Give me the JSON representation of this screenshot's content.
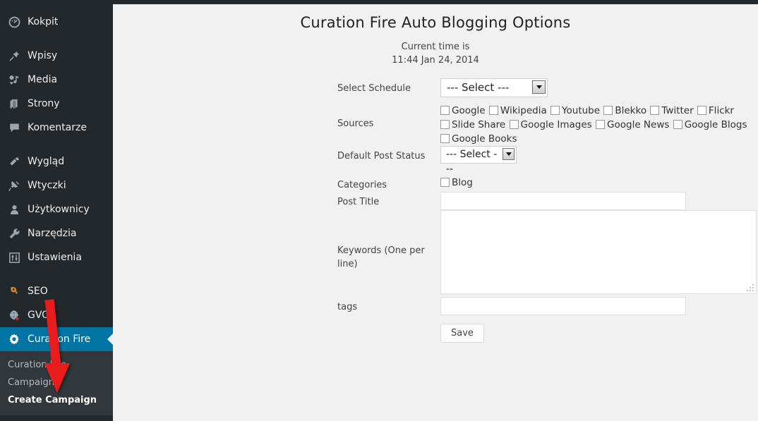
{
  "sidebar": {
    "groups": [
      {
        "items": [
          {
            "label": "Kokpit",
            "icon": "dashboard-icon"
          }
        ]
      },
      {
        "items": [
          {
            "label": "Wpisy",
            "icon": "pin-icon"
          },
          {
            "label": "Media",
            "icon": "media-icon"
          },
          {
            "label": "Strony",
            "icon": "pages-icon"
          },
          {
            "label": "Komentarze",
            "icon": "comment-icon"
          }
        ]
      },
      {
        "items": [
          {
            "label": "Wygląd",
            "icon": "appearance-brush-icon"
          },
          {
            "label": "Wtyczki",
            "icon": "plugins-plug-icon"
          },
          {
            "label": "Użytkownicy",
            "icon": "users-icon"
          },
          {
            "label": "Narzędzia",
            "icon": "tools-wrench-icon"
          },
          {
            "label": "Ustawienia",
            "icon": "settings-sliders-icon"
          }
        ]
      },
      {
        "items": [
          {
            "label": "SEO",
            "icon": "seo-yoast-icon"
          },
          {
            "label": "GVO",
            "icon": "gvo-globe-icon"
          }
        ]
      }
    ],
    "active_item": {
      "label": "Curation Fire",
      "icon": "gear-icon"
    },
    "submenu": [
      {
        "label": "Curation Fire",
        "current": false
      },
      {
        "label": "Campaigns",
        "current": false
      },
      {
        "label": "Create Campaign",
        "current": true
      }
    ],
    "colors": {
      "background": "#23282d",
      "submenu_background": "#32373c",
      "active": "#0074a2",
      "icon": "#a0a5aa",
      "label": "#eeeeee"
    }
  },
  "header": {
    "title": "Curation Fire Auto Blogging Options",
    "current_time_label": "Current time is",
    "current_time_value": "11:44 Jan 24, 2014"
  },
  "form": {
    "schedule": {
      "label": "Select Schedule",
      "value": "--- Select ---"
    },
    "sources": {
      "label": "Sources",
      "items": [
        {
          "label": "Google",
          "checked": false
        },
        {
          "label": "Wikipedia",
          "checked": false
        },
        {
          "label": "Youtube",
          "checked": false
        },
        {
          "label": "Blekko",
          "checked": false
        },
        {
          "label": "Twitter",
          "checked": false
        },
        {
          "label": "Flickr",
          "checked": false
        },
        {
          "label": "Slide Share",
          "checked": false
        },
        {
          "label": "Google Images",
          "checked": false
        },
        {
          "label": "Google News",
          "checked": false
        },
        {
          "label": "Google Blogs",
          "checked": false
        },
        {
          "label": "Google Books",
          "checked": false
        }
      ]
    },
    "post_status": {
      "label": "Default Post Status",
      "value": "--- Select ---"
    },
    "categories": {
      "label": "Categories",
      "items": [
        {
          "label": "Blog",
          "checked": false
        }
      ]
    },
    "post_title": {
      "label": "Post Title",
      "value": ""
    },
    "keywords": {
      "label": "Keywords (One per line)",
      "value": ""
    },
    "tags": {
      "label": "tags",
      "value": ""
    },
    "save_button": "Save"
  },
  "annotation": {
    "type": "red-arrow",
    "color": "#e81c1c",
    "points_to": "Create Campaign"
  }
}
